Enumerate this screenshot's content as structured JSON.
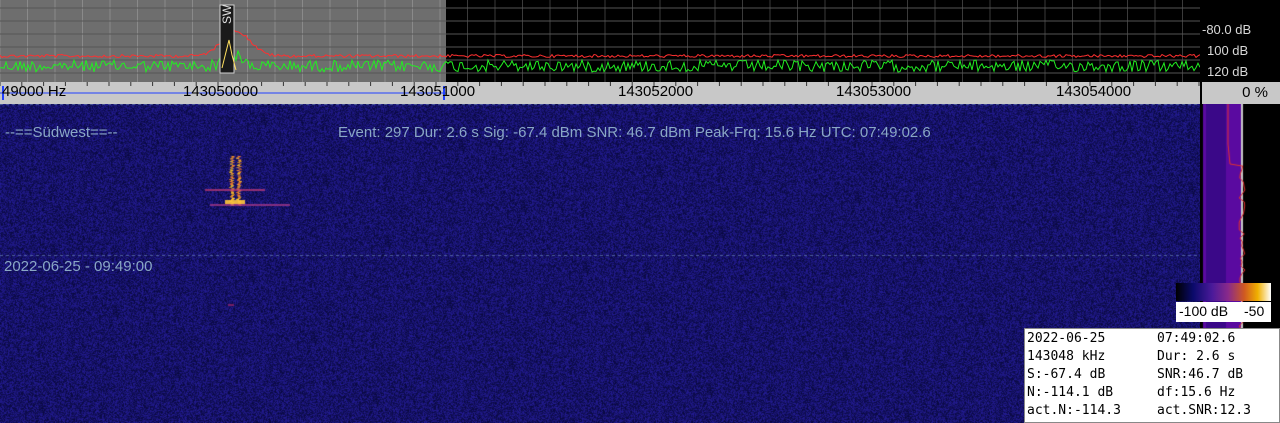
{
  "spectrum": {
    "db_labels": [
      "-80.0 dB",
      "100 dB",
      "120 dB"
    ],
    "marker_label": "SW",
    "colors": {
      "noise_trace": "#22ee22",
      "peak_trace": "#ff3030",
      "marker": "#e0e0e0"
    }
  },
  "frequency_axis": {
    "labels": [
      "49000 Hz",
      "143050000",
      "143051000",
      "143052000",
      "143053000",
      "143054000"
    ],
    "percent": "0 %"
  },
  "waterfall": {
    "station": "--==Südwest==--",
    "event_info": "Event: 297   Dur: 2.6 s   Sig: -67.4 dBm   SNR: 46.7 dBm   Peak-Frq: 15.6 Hz   UTC: 07:49:02.6",
    "timestamp": "2022-06-25 - 09:49:00",
    "colors": {
      "background": "#0a0a4a",
      "text": "#8aa7c6"
    }
  },
  "colorbar": {
    "min_label": "-100 dB",
    "max_label": "-50"
  },
  "infobox": {
    "rows": [
      [
        "2022-06-25",
        "07:49:02.6"
      ],
      [
        "143048 kHz",
        "Dur: 2.6 s"
      ],
      [
        "S:-67.4 dB",
        "SNR:46.7 dB"
      ],
      [
        "N:-114.1 dB",
        "df:15.6 Hz"
      ],
      [
        "act.N:-114.3",
        "act.SNR:12.3"
      ]
    ]
  }
}
